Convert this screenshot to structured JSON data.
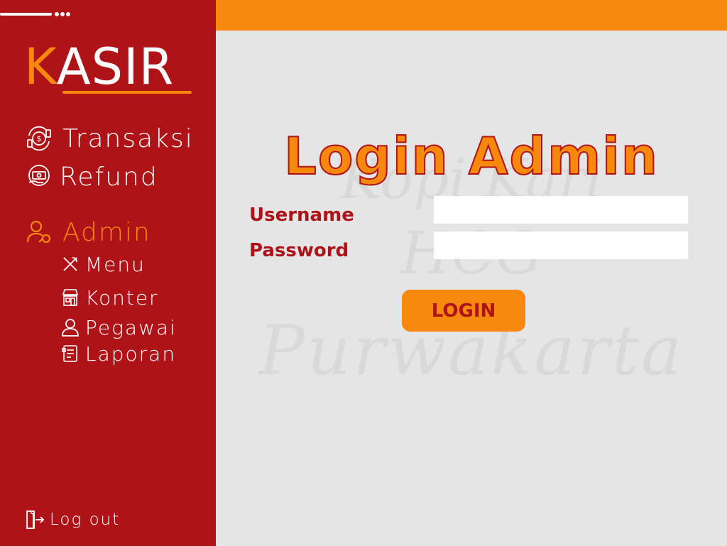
{
  "colors": {
    "sidebar_bg": "#ae1318",
    "accent_orange": "#f6890d",
    "content_bg": "#e5e5e5",
    "text_white": "#ffffff"
  },
  "sidebar": {
    "logo": {
      "first_letter": "K",
      "rest": "ASIR"
    },
    "nav": {
      "transaksi": {
        "label": "Transaksi",
        "icon": "money-exchange-icon"
      },
      "refund": {
        "label": "Refund",
        "icon": "cash-hand-icon"
      },
      "admin": {
        "label": "Admin",
        "icon": "admin-user-key-icon"
      },
      "menu": {
        "label": "Menu",
        "icon": "utensils-icon"
      },
      "konter": {
        "label": "Konter",
        "icon": "store-icon"
      },
      "pegawai": {
        "label": "Pegawai",
        "icon": "person-icon"
      },
      "laporan": {
        "label": "Laporan",
        "icon": "report-icon"
      }
    },
    "logout": {
      "label": "Log out",
      "icon": "door-exit-icon"
    }
  },
  "watermark": {
    "line1": "Kopi Kari",
    "line2": "HCG",
    "line3": "Purwakarta"
  },
  "login": {
    "title": "Login Admin",
    "username_label": "Username",
    "username_value": "",
    "password_label": "Password",
    "password_value": "",
    "button_label": "LOGIN"
  }
}
